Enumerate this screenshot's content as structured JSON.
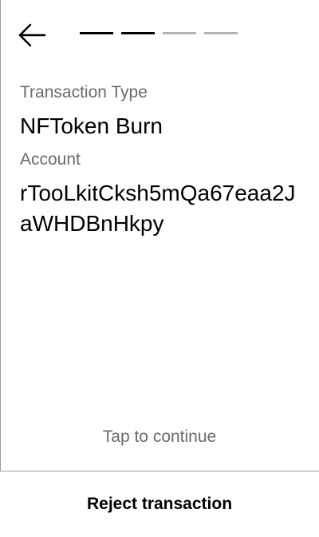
{
  "header": {
    "back_icon": "arrow-left-icon",
    "progress": {
      "total_steps": 4,
      "completed_steps": 2
    }
  },
  "fields": {
    "transaction_type_label": "Transaction Type",
    "transaction_type_value": "NFToken Burn",
    "account_label": "Account",
    "account_value": "rTooLkitCksh5mQa67eaa2JaWHDBnHkpy"
  },
  "footer": {
    "tap_hint": "Tap to continue",
    "reject_label": "Reject transaction"
  },
  "colors": {
    "background": "#ffffff",
    "text_primary": "#000000",
    "text_secondary": "#6a6a6a",
    "progress_done": "#000000",
    "progress_pending": "#b3b3b3",
    "divider": "#9a9a9a"
  }
}
